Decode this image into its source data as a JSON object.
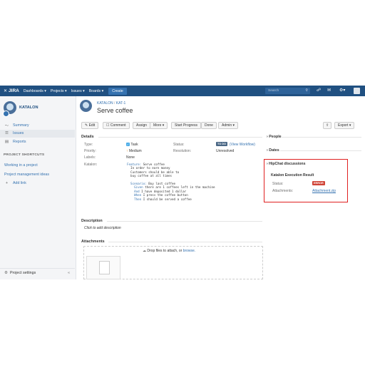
{
  "topnav": {
    "logo": "JIRA",
    "dashboards": "Dashboards ▾",
    "projects": "Projects ▾",
    "issues": "Issues ▾",
    "boards": "Boards ▾",
    "create": "Create",
    "search_placeholder": "Search"
  },
  "sidebar": {
    "project_name": "KATALON",
    "summary": "Summary",
    "issues": "Issues",
    "reports": "Reports",
    "shortcuts_header": "PROJECT SHORTCUTS",
    "shortcut1": "Working in a project",
    "shortcut2": "Project management ideas",
    "add_link": "Add link",
    "settings": "Project settings",
    "collapse": "«"
  },
  "issue": {
    "breadcrumb_project": "KATALON",
    "breadcrumb_sep": "/",
    "breadcrumb_key": "KAT-1",
    "title": "Serve coffee"
  },
  "toolbar": {
    "edit": "✎ Edit",
    "comment": "☐ Comment",
    "assign": "Assign",
    "more": "More ▾",
    "start_progress": "Start Progress",
    "done": "Done",
    "admin": "Admin ▾",
    "export": "Export ▾"
  },
  "details": {
    "header": "Details",
    "type_label": "Type:",
    "type_value": "Task",
    "priority_label": "Priority:",
    "priority_value": "Medium",
    "labels_label": "Labels:",
    "labels_value": "None",
    "katalon_label": "Katalon:",
    "status_label": "Status:",
    "status_value": "TO DO",
    "workflow_link": "(View Workflow)",
    "resolution_label": "Resolution:",
    "resolution_value": "Unresolved"
  },
  "gherkin": {
    "l1_kw": "Feature:",
    "l1": " Serve coffee",
    "l2": "  In order to earn money",
    "l3": "  Customers should be able to",
    "l4": "  buy coffee at all times",
    "l5_kw": "  Scenario:",
    "l5": " Buy last coffee",
    "l6_kw": "    Given",
    "l6": " there are 1 coffees left in the machine",
    "l7_kw": "    And",
    "l7": " I have deposited 1 dollar",
    "l8_kw": "    When",
    "l8": " I press the coffee button",
    "l9_kw": "    Then",
    "l9": " I should be served a coffee"
  },
  "description": {
    "header": "Description",
    "placeholder": "Click to add description"
  },
  "attachments": {
    "header": "Attachments",
    "drop_text": "Drop files to attach, or ",
    "browse": "browse."
  },
  "right": {
    "people": "People",
    "dates": "Dates",
    "hipchat": "HipChat discussions",
    "result_header": "Katalon Execution Result",
    "status_label": "Status:",
    "status_value": "ERROR",
    "attachments_label": "Attachments:",
    "attachment_file": "Attachment.zip"
  },
  "colors": {
    "nav": "#205081",
    "link": "#3572b0",
    "highlight": "#e02020",
    "error": "#d04437"
  }
}
